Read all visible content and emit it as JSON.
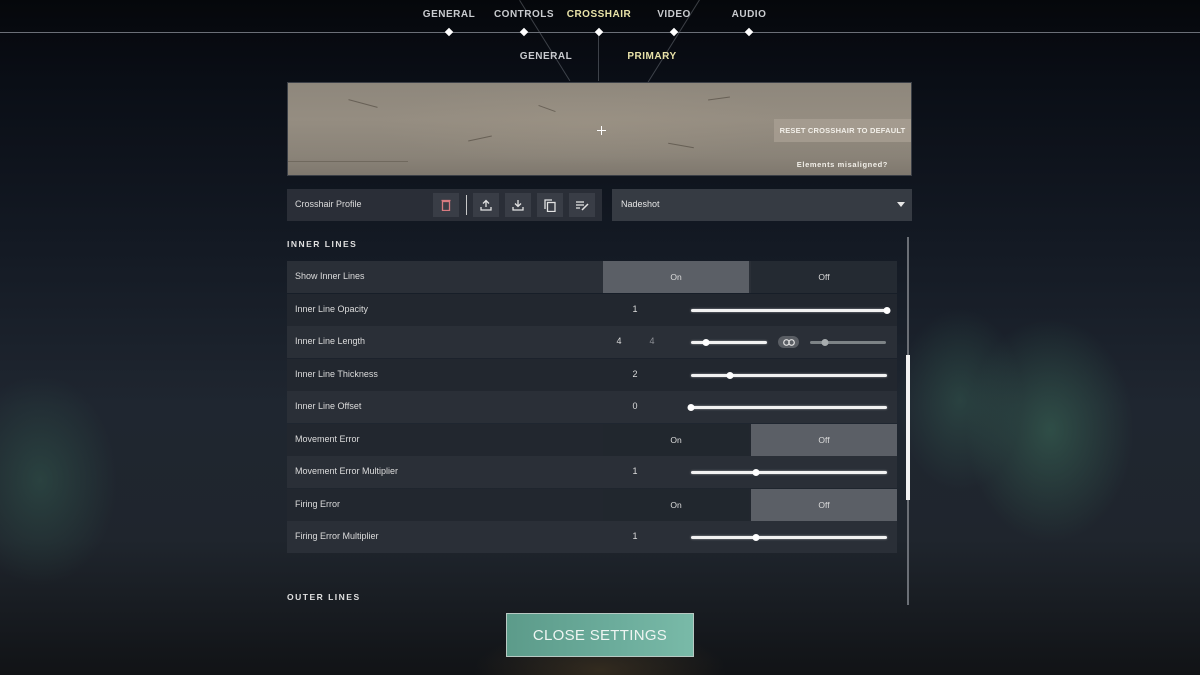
{
  "top_nav": {
    "tabs": [
      {
        "label": "GENERAL",
        "active": false
      },
      {
        "label": "CONTROLS",
        "active": false
      },
      {
        "label": "CROSSHAIR",
        "active": true
      },
      {
        "label": "VIDEO",
        "active": false
      },
      {
        "label": "AUDIO",
        "active": false
      }
    ]
  },
  "sub_nav": {
    "tabs": [
      {
        "label": "GENERAL",
        "active": false
      },
      {
        "label": "PRIMARY",
        "active": true
      }
    ]
  },
  "preview": {
    "reset_label": "RESET CROSSHAIR TO DEFAULT",
    "misaligned_link": "Elements misaligned?"
  },
  "profile": {
    "label": "Crosshair Profile",
    "icons": [
      "delete-icon",
      "export-icon",
      "import-icon",
      "copy-icon",
      "rename-icon"
    ],
    "selected": "Nadeshot"
  },
  "sections": {
    "inner_lines": "INNER LINES",
    "outer_lines": "OUTER LINES"
  },
  "settings": [
    {
      "label": "Show Inner Lines",
      "type": "toggle",
      "on_label": "On",
      "off_label": "Off",
      "value": "On"
    },
    {
      "label": "Inner Line Opacity",
      "type": "slider",
      "value": "1",
      "fraction": 1.0
    },
    {
      "label": "Inner Line Length",
      "type": "dual-slider",
      "value": "4",
      "value2": "4",
      "fraction": 0.2,
      "fraction2": 0.2,
      "linked": true
    },
    {
      "label": "Inner Line Thickness",
      "type": "slider",
      "value": "2",
      "fraction": 0.2
    },
    {
      "label": "Inner Line Offset",
      "type": "slider",
      "value": "0",
      "fraction": 0.0
    },
    {
      "label": "Movement Error",
      "type": "toggle",
      "on_label": "On",
      "off_label": "Off",
      "value": "Off"
    },
    {
      "label": "Movement Error Multiplier",
      "type": "slider",
      "value": "1",
      "fraction": 0.33
    },
    {
      "label": "Firing Error",
      "type": "toggle",
      "on_label": "On",
      "off_label": "Off",
      "value": "Off"
    },
    {
      "label": "Firing Error Multiplier",
      "type": "slider",
      "value": "1",
      "fraction": 0.33
    }
  ],
  "scroll": {
    "position_fraction": 0.32
  },
  "close_button": "CLOSE SETTINGS"
}
